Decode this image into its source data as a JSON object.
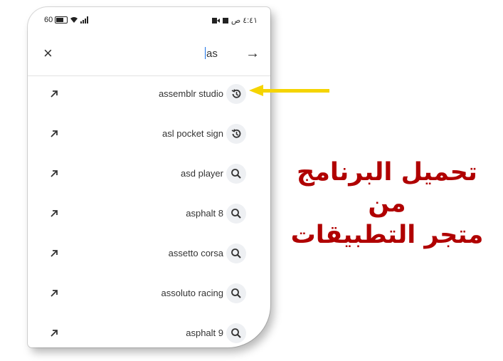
{
  "status_bar": {
    "time": "٤:٤١ ص",
    "left_indicator": "60"
  },
  "search": {
    "query": "as",
    "close_symbol": "×",
    "go_symbol": "→"
  },
  "suggestions": [
    {
      "label": "assemblr studio",
      "icon": "history-icon"
    },
    {
      "label": "asl pocket sign",
      "icon": "history-icon"
    },
    {
      "label": "asd player",
      "icon": "search-icon"
    },
    {
      "label": "asphalt 8",
      "icon": "search-icon"
    },
    {
      "label": "assetto corsa",
      "icon": "search-icon"
    },
    {
      "label": "assoluto racing",
      "icon": "search-icon"
    },
    {
      "label": "asphalt 9",
      "icon": "search-icon"
    }
  ],
  "annotation": {
    "arrow_color": "#f5d400",
    "caption_line1": "تحميل البرنامج من",
    "caption_line2": "متجر التطبيقات",
    "caption_color": "#b00000"
  }
}
